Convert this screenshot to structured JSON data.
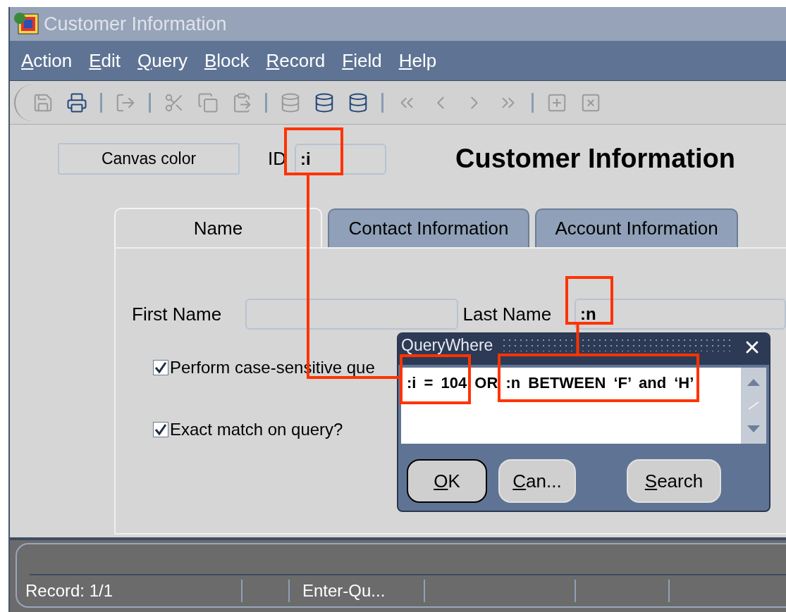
{
  "window": {
    "title": "Customer Information"
  },
  "menu": [
    {
      "label": "Action"
    },
    {
      "label": "Edit"
    },
    {
      "label": "Query"
    },
    {
      "label": "Block"
    },
    {
      "label": "Record"
    },
    {
      "label": "Field"
    },
    {
      "label": "Help"
    }
  ],
  "canvas_button": "Canvas color",
  "id_field": {
    "label": "ID",
    "value": ":i"
  },
  "heading": "Customer Information",
  "tabs": [
    {
      "label": "Name",
      "selected": true
    },
    {
      "label": "Contact Information",
      "selected": false
    },
    {
      "label": "Account Information",
      "selected": false
    }
  ],
  "fields": [
    {
      "label": "First Name"
    },
    {
      "label": "Last Name",
      "value": ":n"
    }
  ],
  "checkboxes": [
    {
      "label": "Perform case-sensitive que",
      "checked": true
    },
    {
      "label": "Exact match on query?",
      "checked": true
    }
  ],
  "dialog": {
    "title": "QueryWhere",
    "query": ":i = 104 OR :n BETWEEN ‘F’ and ‘H’",
    "buttons": [
      {
        "label": "OK",
        "default": true
      },
      {
        "label": "Can...",
        "default": false
      },
      {
        "label": "Search",
        "default": false
      }
    ]
  },
  "status_bar": {
    "record": "Record: 1/1",
    "mode": "Enter-Qu..."
  }
}
